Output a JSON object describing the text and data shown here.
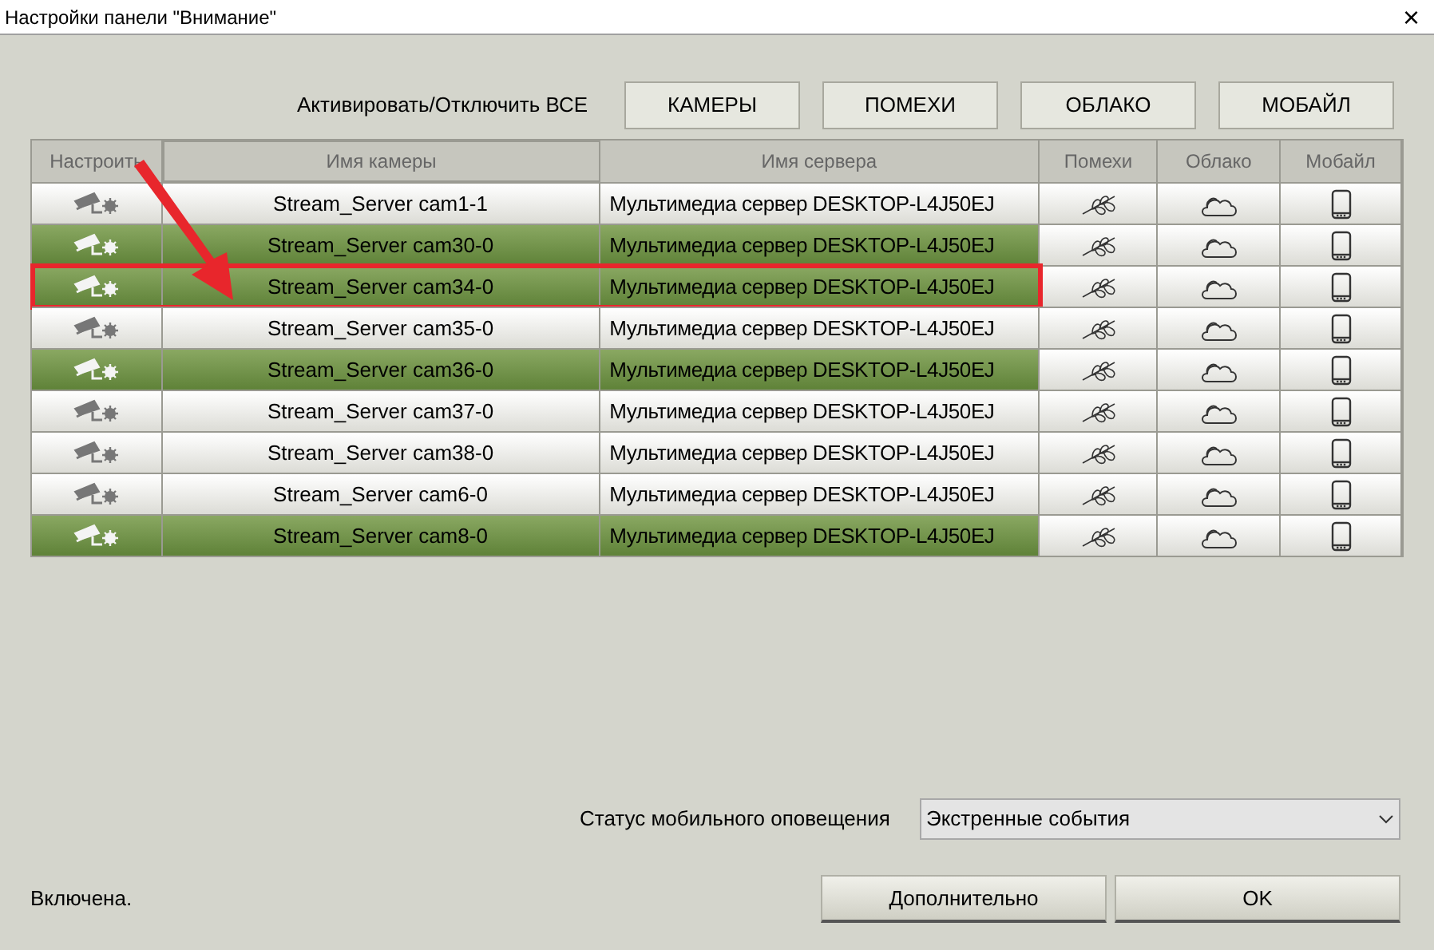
{
  "window": {
    "title": "Настройки панели \"Внимание\"",
    "close": "×"
  },
  "toggle_all": {
    "label": "Активировать/Отключить ВСЕ",
    "buttons": [
      "КАМЕРЫ",
      "ПОМЕХИ",
      "ОБЛАКО",
      "МОБАЙЛ"
    ]
  },
  "table": {
    "columns": [
      "Настроить",
      "Имя камеры",
      "Имя сервера",
      "Помехи",
      "Облако",
      "Мобайл"
    ],
    "rows": [
      {
        "camera": "Stream_Server cam1-1",
        "server": "Мультимедиа сервер DESKTOP-L4J50EJ",
        "active": false,
        "highlighted": false
      },
      {
        "camera": "Stream_Server cam30-0",
        "server": "Мультимедиа сервер DESKTOP-L4J50EJ",
        "active": true,
        "highlighted": false
      },
      {
        "camera": "Stream_Server cam34-0",
        "server": "Мультимедиа сервер DESKTOP-L4J50EJ",
        "active": true,
        "highlighted": true
      },
      {
        "camera": "Stream_Server cam35-0",
        "server": "Мультимедиа сервер DESKTOP-L4J50EJ",
        "active": false,
        "highlighted": false
      },
      {
        "camera": "Stream_Server cam36-0",
        "server": "Мультимедиа сервер DESKTOP-L4J50EJ",
        "active": true,
        "highlighted": false
      },
      {
        "camera": "Stream_Server cam37-0",
        "server": "Мультимедиа сервер DESKTOP-L4J50EJ",
        "active": false,
        "highlighted": false
      },
      {
        "camera": "Stream_Server cam38-0",
        "server": "Мультимедиа сервер DESKTOP-L4J50EJ",
        "active": false,
        "highlighted": false
      },
      {
        "camera": "Stream_Server cam6-0",
        "server": "Мультимедиа сервер DESKTOP-L4J50EJ",
        "active": false,
        "highlighted": false
      },
      {
        "camera": "Stream_Server cam8-0",
        "server": "Мультимедиа сервер DESKTOP-L4J50EJ",
        "active": true,
        "highlighted": false
      }
    ]
  },
  "mobile_status": {
    "label": "Статус мобильного оповещения",
    "value": "Экстренные события"
  },
  "status": "Включена.",
  "buttons": [
    "Дополнительно",
    "OK"
  ]
}
